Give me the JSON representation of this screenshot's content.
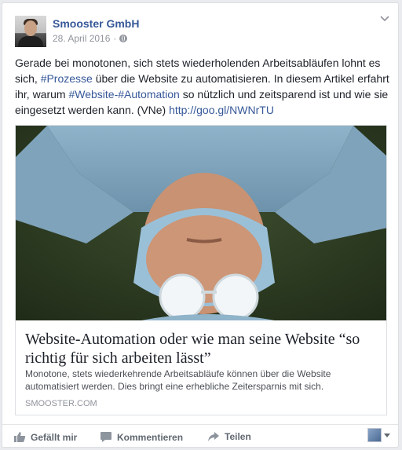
{
  "post": {
    "page_name": "Smooster GmbH",
    "date": "28. April 2016",
    "separator": "·",
    "privacy_icon": "globe-icon",
    "menu_icon": "chevron-down-icon",
    "text": {
      "line1": "Gerade bei monotonen, sich stets wiederholenden Arbeitsabläufen lohnt es",
      "sich": "sich, ",
      "hashtag1": "#Prozesse",
      "mid1": " über die Website zu automatisieren. In diesem Artikel erfahrt ihr, warum ",
      "hashtag2": "#Website-#Automation",
      "mid2": " so nützlich und zeitsparend ist und wie sie eingesetzt werden kann. (VNe) ",
      "link": "http://goo.gl/NWNrTU"
    }
  },
  "attachment": {
    "title": "Website-Automation oder wie man seine Website “so richtig für sich arbeiten lässt”",
    "description": "Monotone, stets wiederkehrende Arbeitsabläufe können über die Website automatisiert werden. Dies bringt eine erhebliche Zeitersparnis mit sich.",
    "domain": "SMOOSTER.COM"
  },
  "actions": {
    "like": "Gefällt mir",
    "comment": "Kommentieren",
    "share": "Teilen"
  },
  "colors": {
    "link_blue": "#365899",
    "text": "#1d2129",
    "muted": "#90949c",
    "background": "#e9ebee"
  }
}
